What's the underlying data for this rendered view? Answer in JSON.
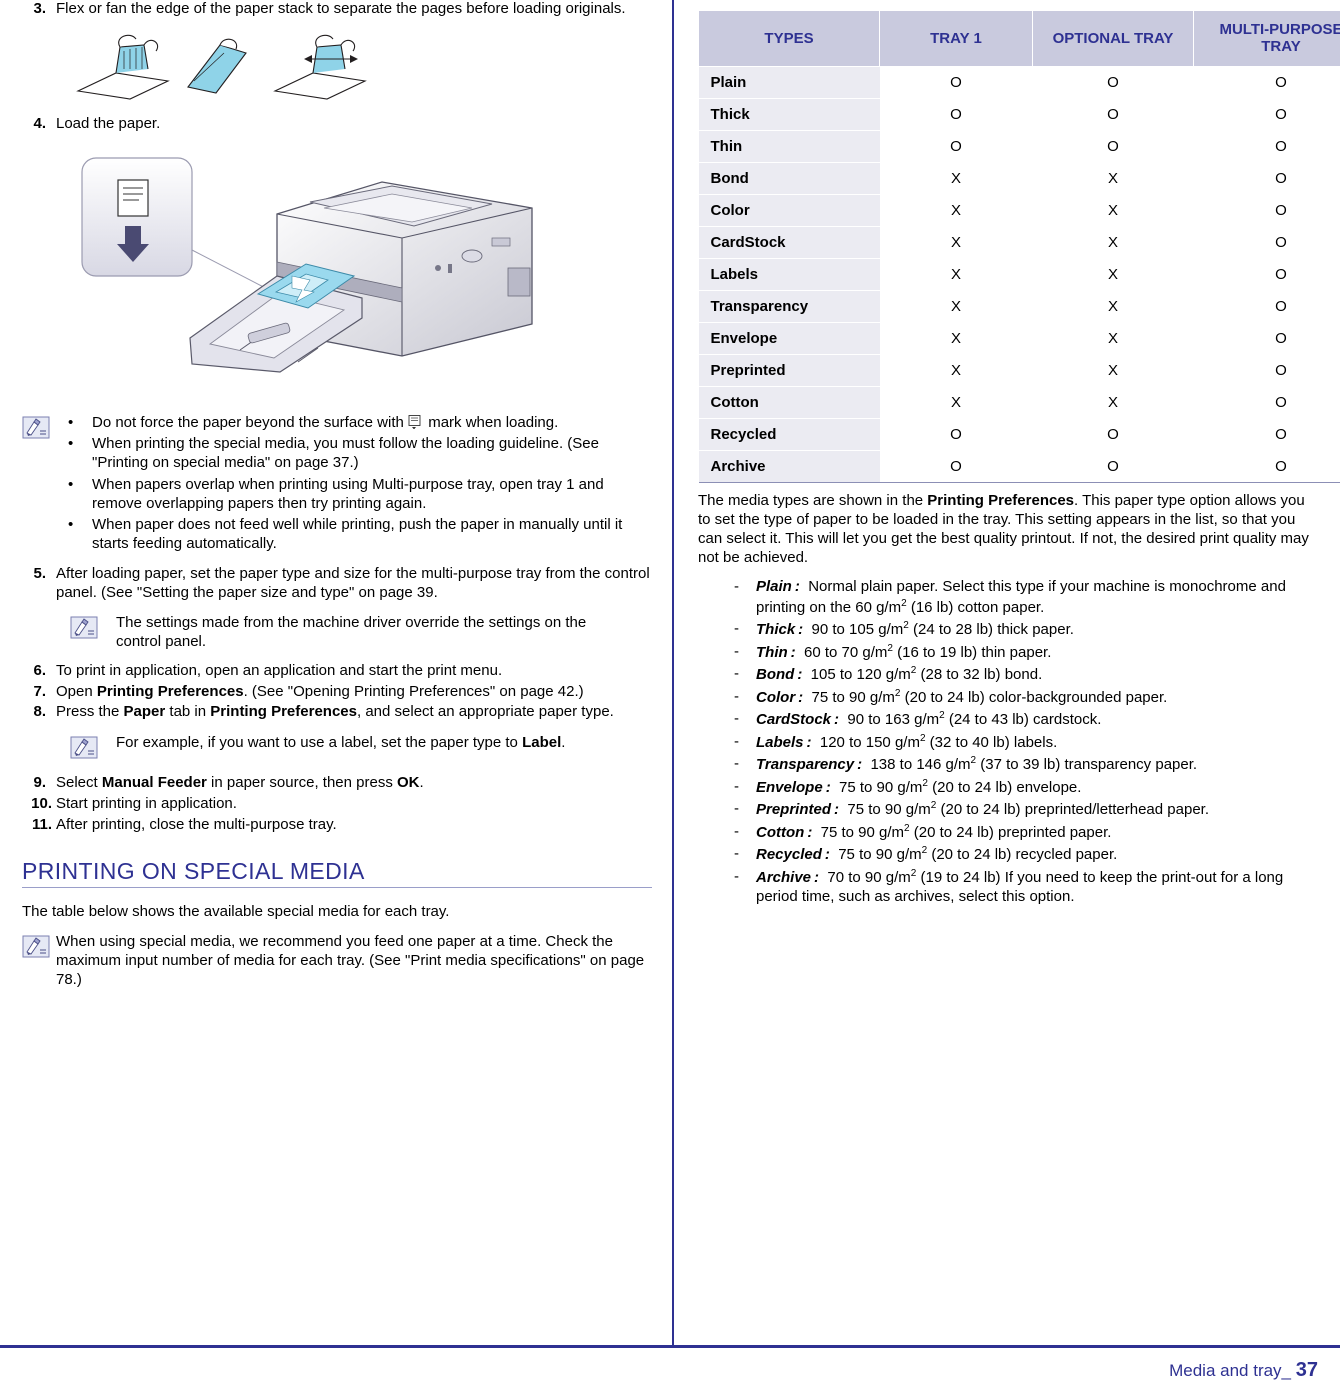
{
  "left": {
    "steps": [
      {
        "num": "3.",
        "text": "Flex or fan the edge of the paper stack to separate the pages before loading originals."
      },
      {
        "num": "4.",
        "text": "Load the paper."
      }
    ],
    "note1": {
      "bullets": [
        {
          "pre": "Do not force the paper beyond the surface with ",
          "icon": "paper-mark-icon",
          "post": " mark when loading."
        },
        {
          "pre": "When printing the special media, you must follow the loading guideline. (See \"Printing on special media\" on page 37.)",
          "post": ""
        },
        {
          "pre": "When papers overlap when printing using Multi-purpose tray, open tray 1 and remove overlapping papers then try printing again.",
          "post": ""
        },
        {
          "pre": "When paper does not feed well while printing, push the paper in manually until it starts feeding automatically.",
          "post": ""
        }
      ]
    },
    "step5": {
      "num": "5.",
      "text": "After loading paper, set the paper type and size for the multi-purpose tray from the control panel. (See \"Setting the paper size and type\" on page 39."
    },
    "note2": "The settings made from the machine driver override the settings on the control panel.",
    "step6": {
      "num": "6.",
      "text": "To print in application, open an application and start the print menu."
    },
    "step7": {
      "num": "7.",
      "pre": "Open ",
      "bold": "Printing Preferences",
      "post": ". (See \"Opening Printing Preferences\" on page 42.)"
    },
    "step8": {
      "num": "8.",
      "pre": "Press the ",
      "bold1": "Paper",
      "mid": " tab in ",
      "bold2": "Printing Preferences",
      "post": ", and select an appropriate paper type."
    },
    "note3": {
      "pre": "For example, if you want to use a label, set the paper type to ",
      "bold": "Label",
      "post": "."
    },
    "step9": {
      "num": "9.",
      "pre": "Select ",
      "bold1": "Manual Feeder",
      "mid": " in paper source, then press ",
      "bold2": "OK",
      "post": "."
    },
    "step10": {
      "num": "10.",
      "text": "Start printing in application."
    },
    "step11": {
      "num": "11.",
      "text": "After printing, close the multi-purpose tray."
    },
    "section_title": "PRINTING ON SPECIAL MEDIA",
    "intro": "The table below shows the available special media for each tray.",
    "note4": "When using special media, we recommend you feed one paper at a time. Check the maximum input number of media for each tray. (See \"Print media specifications\" on page 78.)"
  },
  "right": {
    "table": {
      "headers": [
        "TYPES",
        "TRAY 1",
        "OPTIONAL TRAY",
        "MULTI-PURPOSE TRAY"
      ],
      "rows": [
        {
          "type": "Plain",
          "tray1": "O",
          "optional": "O",
          "multi": "O"
        },
        {
          "type": "Thick",
          "tray1": "O",
          "optional": "O",
          "multi": "O"
        },
        {
          "type": "Thin",
          "tray1": "O",
          "optional": "O",
          "multi": "O"
        },
        {
          "type": "Bond",
          "tray1": "X",
          "optional": "X",
          "multi": "O"
        },
        {
          "type": "Color",
          "tray1": "X",
          "optional": "X",
          "multi": "O"
        },
        {
          "type": "CardStock",
          "tray1": "X",
          "optional": "X",
          "multi": "O"
        },
        {
          "type": "Labels",
          "tray1": "X",
          "optional": "X",
          "multi": "O"
        },
        {
          "type": "Transparency",
          "tray1": "X",
          "optional": "X",
          "multi": "O"
        },
        {
          "type": "Envelope",
          "tray1": "X",
          "optional": "X",
          "multi": "O"
        },
        {
          "type": "Preprinted",
          "tray1": "X",
          "optional": "X",
          "multi": "O"
        },
        {
          "type": "Cotton",
          "tray1": "X",
          "optional": "X",
          "multi": "O"
        },
        {
          "type": "Recycled",
          "tray1": "O",
          "optional": "O",
          "multi": "O"
        },
        {
          "type": "Archive",
          "tray1": "O",
          "optional": "O",
          "multi": "O"
        }
      ]
    },
    "para": {
      "p1": "The media types are shown in the ",
      "p1b": "Printing Preferences",
      "p1c": ". This paper type option allows you to set the type of paper to be loaded in the tray. This setting appears in the list, so that you can select it. This will let you get the best quality printout. If not, the desired print quality may not be achieved."
    },
    "definitions": [
      {
        "term": "Plain :",
        "d1": "Normal plain paper. Select this type if your machine is monochrome and printing on the 60 g/m",
        "sup": "2",
        "d2": " (16 lb) cotton paper."
      },
      {
        "term": "Thick :",
        "d1": "90 to 105 g/m",
        "sup": "2",
        "d2": " (24 to 28 lb) thick paper."
      },
      {
        "term": "Thin :",
        "d1": "60 to 70 g/m",
        "sup": "2",
        "d2": " (16 to 19 lb) thin paper."
      },
      {
        "term": "Bond :",
        "d1": "105 to 120 g/m",
        "sup": "2",
        "d2": " (28 to 32 lb) bond."
      },
      {
        "term": "Color :",
        "d1": "75 to 90 g/m",
        "sup": "2",
        "d2": " (20 to 24 lb) color-backgrounded paper."
      },
      {
        "term": "CardStock :",
        "d1": "90 to 163 g/m",
        "sup": "2",
        "d2": " (24 to 43 lb) cardstock."
      },
      {
        "term": "Labels :",
        "d1": "120 to 150 g/m",
        "sup": "2",
        "d2": " (32 to 40 lb) labels."
      },
      {
        "term": "Transparency :",
        "d1": "138 to 146 g/m",
        "sup": "2",
        "d2": " (37 to 39 lb) transparency paper."
      },
      {
        "term": "Envelope :",
        "d1": "75 to 90 g/m",
        "sup": "2",
        "d2": " (20 to 24 lb) envelope."
      },
      {
        "term": "Preprinted :",
        "d1": "75 to 90 g/m",
        "sup": "2",
        "d2": " (20 to 24 lb) preprinted/letterhead paper."
      },
      {
        "term": "Cotton :",
        "d1": "75 to 90 g/m",
        "sup": "2",
        "d2": " (20 to 24 lb) preprinted paper."
      },
      {
        "term": "Recycled :",
        "d1": "75 to 90 g/m",
        "sup": "2",
        "d2": " (20 to 24 lb) recycled paper."
      },
      {
        "term": "Archive :",
        "d1": "70 to 90 g/m",
        "sup": "2",
        "d2": " (19 to 24 lb) If you need to keep the print-out for a long period time, such as archives, select this option."
      }
    ]
  },
  "footer": {
    "label": "Media and tray_",
    "page": "37"
  }
}
